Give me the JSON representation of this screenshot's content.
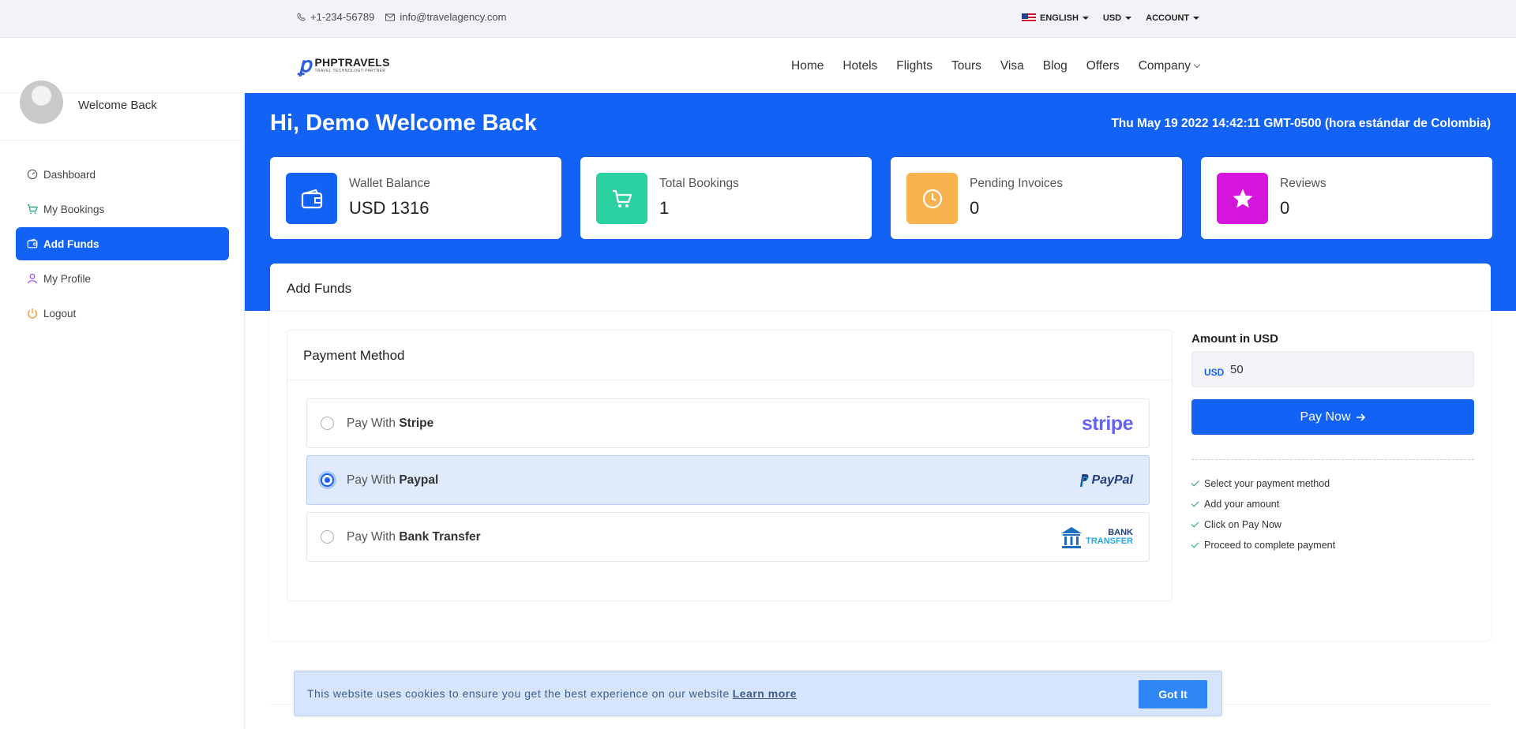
{
  "topbar": {
    "phone": "+1-234-56789",
    "email": "info@travelagency.com",
    "language": "ENGLISH",
    "currency": "USD",
    "account": "ACCOUNT"
  },
  "brand": {
    "name": "PHPTRAVELS",
    "tagline": "TRAVEL TECHNOLOGY PARTNER"
  },
  "nav": {
    "items": [
      "Home",
      "Hotels",
      "Flights",
      "Tours",
      "Visa",
      "Blog",
      "Offers"
    ],
    "company": "Company"
  },
  "sidebar": {
    "welcome": "Welcome Back",
    "items": [
      {
        "label": "Dashboard",
        "icon": "speedometer-icon",
        "color": "#555555"
      },
      {
        "label": "My Bookings",
        "icon": "cart-icon",
        "color": "#17a56a"
      },
      {
        "label": "Add Funds",
        "icon": "wallet-icon",
        "color": "#ffffff",
        "active": true
      },
      {
        "label": "My Profile",
        "icon": "user-icon",
        "color": "#8a3ff0"
      },
      {
        "label": "Logout",
        "icon": "power-icon",
        "color": "#f08a1a"
      }
    ]
  },
  "dashboard": {
    "greeting": "Hi, Demo Welcome Back",
    "datetime": "Thu May 19 2022 14:42:11 GMT-0500 (hora estándar de Colombia)",
    "cards": [
      {
        "label": "Wallet Balance",
        "value": "USD 1316",
        "icon": "wallet-icon",
        "color": "#1262f5"
      },
      {
        "label": "Total Bookings",
        "value": "1",
        "icon": "cart-icon",
        "color": "#2bd1a1"
      },
      {
        "label": "Pending Invoices",
        "value": "0",
        "icon": "clock-icon",
        "color": "#f8b34e"
      },
      {
        "label": "Reviews",
        "value": "0",
        "icon": "star-icon",
        "color": "#d416dc"
      }
    ]
  },
  "add_funds": {
    "title": "Add Funds",
    "payment_method_title": "Payment Method",
    "pay_with": "Pay With",
    "options": [
      {
        "name": "Stripe",
        "selected": false,
        "logo": "stripe"
      },
      {
        "name": "Paypal",
        "selected": true,
        "logo": "PayPal"
      },
      {
        "name": "Bank Transfer",
        "selected": false,
        "logo_top": "BANK",
        "logo_bottom": "TRANSFER"
      }
    ],
    "amount_label": "Amount in USD",
    "currency_tag": "USD",
    "amount_value": "50",
    "pay_button": "Pay Now",
    "steps": [
      "Select your payment method",
      "Add your amount",
      "Click on Pay Now",
      "Proceed to complete payment"
    ]
  },
  "cookie": {
    "message": "This website uses cookies to ensure you get the best experience on our website",
    "link": "Learn more",
    "button": "Got It"
  },
  "colors": {
    "primary": "#1262f5",
    "selected_bg": "#dfeafc",
    "cookie_bg": "#d6e5fb"
  }
}
